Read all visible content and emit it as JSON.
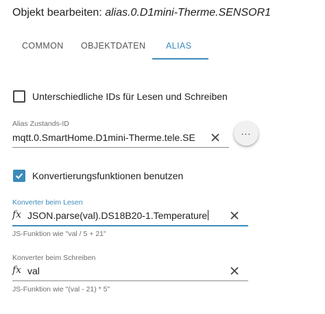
{
  "dialog": {
    "title_prefix": "Objekt bearbeiten: ",
    "title_object": "alias.0.D1mini-Therme.SENSOR1"
  },
  "tabs": [
    {
      "label": "COMMON",
      "active": false
    },
    {
      "label": "OBJEKTDATEN",
      "active": false
    },
    {
      "label": "ALIAS",
      "active": true
    }
  ],
  "alias": {
    "different_ids": {
      "label": "Unterschiedliche IDs für Lesen und Schreiben",
      "checked": false
    },
    "state_id": {
      "label": "Alias Zustands-ID",
      "value": "mqtt.0.SmartHome.D1mini-Therme.tele.SE",
      "more_label": "..."
    },
    "conversion": {
      "label": "Konvertierungsfunktionen benutzen",
      "checked": true
    },
    "read_converter": {
      "label": "Konverter beim Lesen",
      "value": "JSON.parse(val).DS18B20-1.Temperature",
      "helper": "JS-Funktion wie \"val / 5 + 21\""
    },
    "write_converter": {
      "label": "Konverter beim Schreiben",
      "value": "val",
      "helper": "JS-Funktion wie \"(val - 21) * 5\""
    }
  },
  "icons": {
    "fx": "fx",
    "clear": "close-icon",
    "more": "more-horiz-icon",
    "check": "check-icon"
  },
  "colors": {
    "accent": "#3b8bbb",
    "text": "#212121",
    "secondary": "#6f6f6f"
  }
}
